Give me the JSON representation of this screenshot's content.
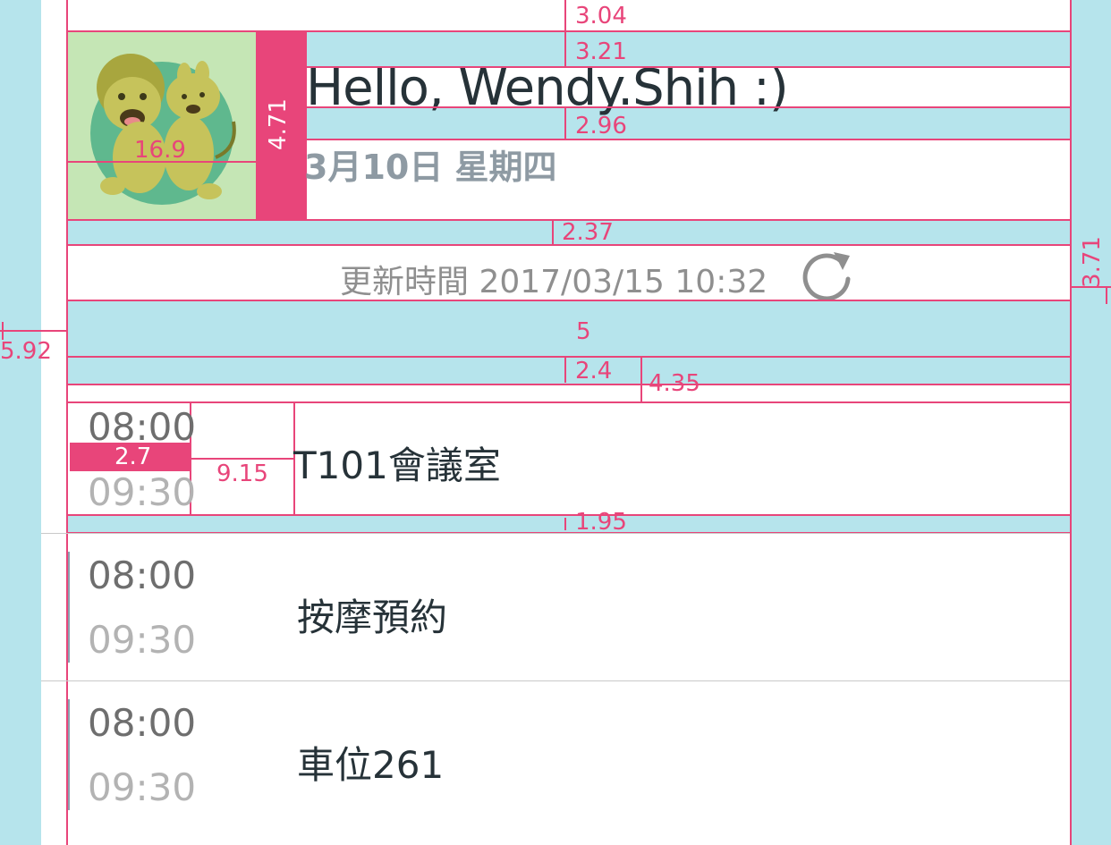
{
  "header": {
    "greeting": "Hello, Wendy.Shih :)",
    "date": "3月10日 星期四"
  },
  "update": {
    "label": "更新時間 2017/03/15 10:32",
    "icon": "refresh-icon"
  },
  "events": [
    {
      "start": "08:00",
      "end": "09:30",
      "title": "T101會議室"
    },
    {
      "start": "08:00",
      "end": "09:30",
      "title": "按摩預約"
    },
    {
      "start": "08:00",
      "end": "09:30",
      "title": "車位261"
    }
  ],
  "measurements": {
    "top": "3.04",
    "greeting_top": "3.21",
    "avatar_size": "16.9",
    "avatar_gap": "4.71",
    "greeting_date_gap": "2.96",
    "header_bottom": "2.37",
    "right_margin": "3.71",
    "left_margin": "5.92",
    "section_gap": "5",
    "list_top_a": "2.4",
    "list_top_b": "4.35",
    "time_gap": "2.7",
    "time_title_gap": "9.15",
    "row_bottom": "1.95"
  },
  "colors": {
    "spacing": "#b6e4ec",
    "guide": "#e8457a",
    "text_primary": "#263238",
    "text_secondary": "#8e9aa3",
    "time_end": "#b3b3b3"
  }
}
